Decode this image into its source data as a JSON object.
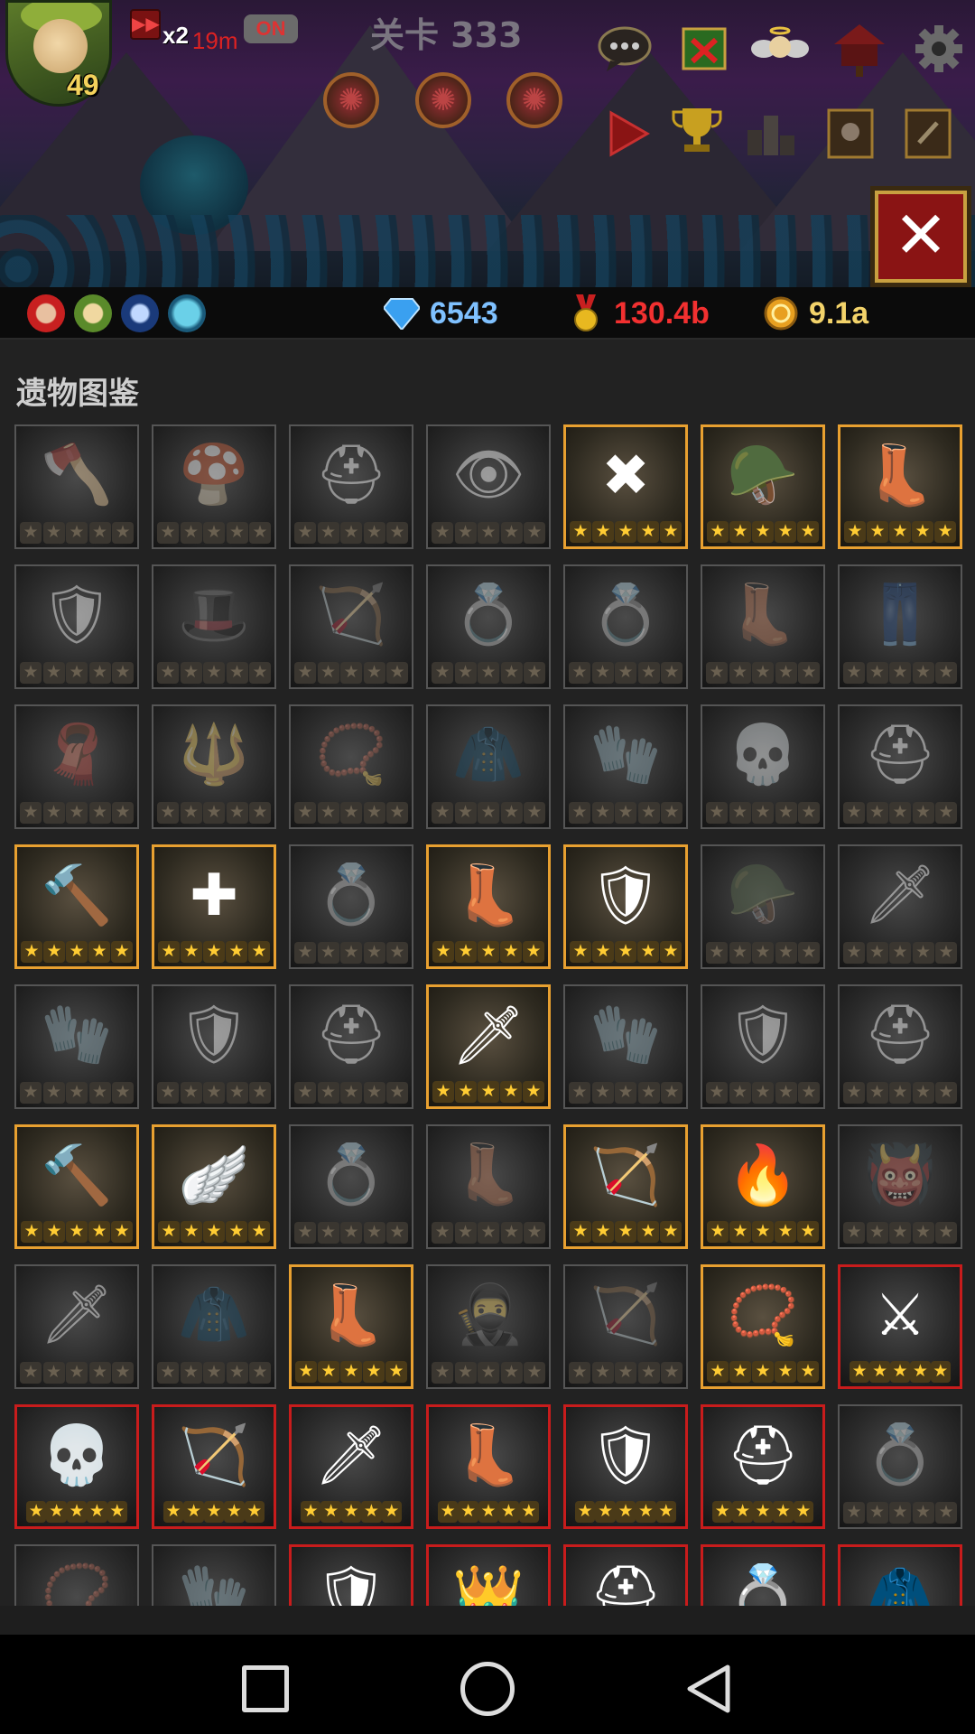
{
  "hud": {
    "hero_level": "49",
    "speed_multiplier": "x2",
    "speed_time": "19m",
    "auto_toggle": "ON",
    "stage_label": "关卡 333"
  },
  "top_icons": [
    "chat-icon",
    "event-banner-icon",
    "angel-icon",
    "mailbox-icon",
    "settings-icon"
  ],
  "row2_icons": [
    "play-icon",
    "trophy-icon",
    "ranking-icon",
    "hero-book-icon",
    "quest-book-icon"
  ],
  "resources": {
    "gems": "6543",
    "medals": "130.4b",
    "gold": "9.1a"
  },
  "colors": {
    "gem": "#7fc1ff",
    "medal": "#f23030",
    "gold": "#f3d36a",
    "owned_border": "#e8a030",
    "special_border": "#c81c1c"
  },
  "panel": {
    "title": "遗物图鉴"
  },
  "relics": [
    {
      "icon": "golden-axe",
      "g": "🪓",
      "state": "locked"
    },
    {
      "icon": "red-mushroom-helm",
      "g": "🍄",
      "state": "locked"
    },
    {
      "icon": "golden-helm",
      "g": "⛑",
      "state": "locked"
    },
    {
      "icon": "eye-orb",
      "g": "👁",
      "state": "locked"
    },
    {
      "icon": "green-crossed-arrows",
      "g": "✖",
      "state": "gold"
    },
    {
      "icon": "winged-helm",
      "g": "🪖",
      "state": "gold"
    },
    {
      "icon": "green-boots",
      "g": "👢",
      "state": "gold"
    },
    {
      "icon": "green-armor",
      "g": "🛡",
      "state": "locked"
    },
    {
      "icon": "green-hat",
      "g": "🎩",
      "state": "locked"
    },
    {
      "icon": "bone-bow",
      "g": "🏹",
      "state": "locked"
    },
    {
      "icon": "blue-ring",
      "g": "💍",
      "state": "locked"
    },
    {
      "icon": "purple-ring",
      "g": "💍",
      "state": "locked"
    },
    {
      "icon": "purple-boots",
      "g": "👢",
      "state": "locked"
    },
    {
      "icon": "purple-pants",
      "g": "👖",
      "state": "locked"
    },
    {
      "icon": "purple-hood",
      "g": "🧣",
      "state": "locked"
    },
    {
      "icon": "dark-staff",
      "g": "🔱",
      "state": "locked"
    },
    {
      "icon": "dark-amulet",
      "g": "📿",
      "state": "locked"
    },
    {
      "icon": "dark-robe",
      "g": "🧥",
      "state": "locked"
    },
    {
      "icon": "dark-gauntlets",
      "g": "🧤",
      "state": "locked"
    },
    {
      "icon": "skull-horns",
      "g": "💀",
      "state": "locked"
    },
    {
      "icon": "horned-helm",
      "g": "⛑",
      "state": "locked"
    },
    {
      "icon": "blue-hammer",
      "g": "🔨",
      "state": "gold"
    },
    {
      "icon": "blue-shuriken",
      "g": "✚",
      "state": "gold"
    },
    {
      "icon": "gold-ring",
      "g": "💍",
      "state": "locked"
    },
    {
      "icon": "crystal-boots",
      "g": "👢",
      "state": "gold"
    },
    {
      "icon": "crystal-armor",
      "g": "🛡",
      "state": "gold"
    },
    {
      "icon": "knight-helm",
      "g": "🪖",
      "state": "locked"
    },
    {
      "icon": "ice-sword",
      "g": "🗡",
      "state": "locked"
    },
    {
      "icon": "dragon-gloves",
      "g": "🧤",
      "state": "locked"
    },
    {
      "icon": "dragon-armor",
      "g": "🛡",
      "state": "locked"
    },
    {
      "icon": "dragon-helm",
      "g": "⛑",
      "state": "locked"
    },
    {
      "icon": "saw-sword",
      "g": "🗡",
      "state": "gold"
    },
    {
      "icon": "ice-gloves",
      "g": "🧤",
      "state": "locked"
    },
    {
      "icon": "ice-armor",
      "g": "🛡",
      "state": "locked"
    },
    {
      "icon": "ice-helm",
      "g": "⛑",
      "state": "locked"
    },
    {
      "icon": "ice-mace",
      "g": "🔨",
      "state": "gold"
    },
    {
      "icon": "golden-wings",
      "g": "🪽",
      "state": "gold"
    },
    {
      "icon": "dragon-ring",
      "g": "💍",
      "state": "locked"
    },
    {
      "icon": "golden-boots",
      "g": "👢",
      "state": "locked"
    },
    {
      "icon": "laurel-bow",
      "g": "🏹",
      "state": "gold"
    },
    {
      "icon": "fire-wings",
      "g": "🔥",
      "state": "gold"
    },
    {
      "icon": "demon-mask",
      "g": "👹",
      "state": "locked"
    },
    {
      "icon": "flame-blade",
      "g": "🗡",
      "state": "locked"
    },
    {
      "icon": "shadow-cloak",
      "g": "🧥",
      "state": "locked"
    },
    {
      "icon": "steel-boots",
      "g": "👢",
      "state": "gold"
    },
    {
      "icon": "dark-hood",
      "g": "🥷",
      "state": "locked"
    },
    {
      "icon": "dragon-bow",
      "g": "🏹",
      "state": "locked"
    },
    {
      "icon": "dragon-necklace",
      "g": "📿",
      "state": "gold"
    },
    {
      "icon": "axe-tome",
      "g": "⚔",
      "state": "red"
    },
    {
      "icon": "skull-tome",
      "g": "💀",
      "state": "red"
    },
    {
      "icon": "arrow-tome",
      "g": "🏹",
      "state": "red"
    },
    {
      "icon": "sword-tome",
      "g": "🗡",
      "state": "red"
    },
    {
      "icon": "silver-boots",
      "g": "👢",
      "state": "red"
    },
    {
      "icon": "silver-armor",
      "g": "🛡",
      "state": "red"
    },
    {
      "icon": "silver-helm",
      "g": "⛑",
      "state": "red"
    },
    {
      "icon": "emerald-ring",
      "g": "💍",
      "state": "locked"
    },
    {
      "icon": "gold-necklace",
      "g": "📿",
      "state": "locked"
    },
    {
      "icon": "jade-gloves",
      "g": "🧤",
      "state": "locked"
    },
    {
      "icon": "jade-armor",
      "g": "🛡",
      "state": "red"
    },
    {
      "icon": "antler-crown",
      "g": "👑",
      "state": "red"
    },
    {
      "icon": "jade-helm",
      "g": "⛑",
      "state": "red"
    },
    {
      "icon": "spiked-ring",
      "g": "💍",
      "state": "red"
    },
    {
      "icon": "black-cloak",
      "g": "🧥",
      "state": "red"
    }
  ]
}
